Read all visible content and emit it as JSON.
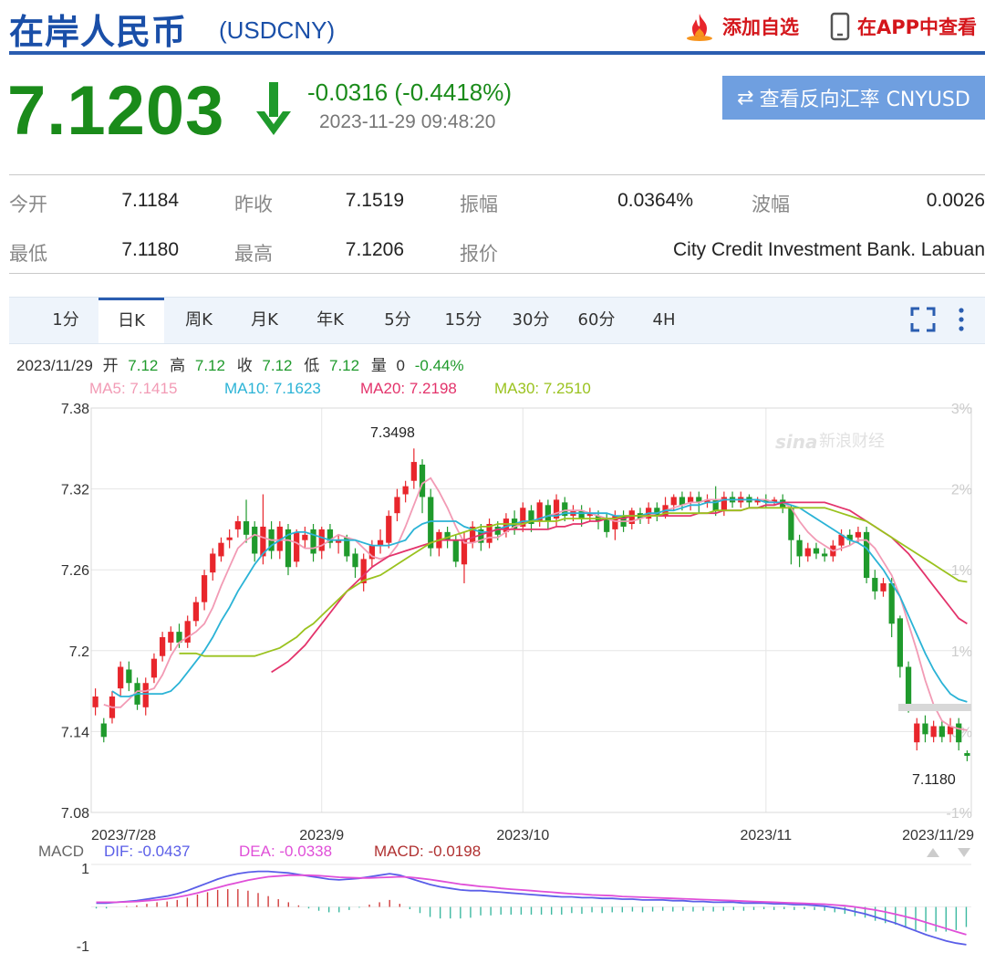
{
  "header": {
    "title": "在岸人民币",
    "code": "(USDCNY)",
    "add_label": "添加自选",
    "app_label": "在APP中查看"
  },
  "quote": {
    "price": "7.1203",
    "change": "-0.0316 (-0.4418%)",
    "time": "2023-11-29 09:48:20",
    "reverse_label": "查看反向汇率 CNYUSD"
  },
  "stats": {
    "open_label": "今开",
    "open": "7.1184",
    "prev_label": "昨收",
    "prev": "7.1519",
    "amp_label": "振幅",
    "amp": "0.0364%",
    "wave_label": "波幅",
    "wave": "0.0026",
    "low_label": "最低",
    "low": "7.1180",
    "high_label": "最高",
    "high": "7.1206",
    "quote_label": "报价",
    "quote": "City Credit Investment Bank. Labuan"
  },
  "tabs": [
    "1分",
    "日K",
    "周K",
    "月K",
    "年K",
    "5分",
    "15分",
    "30分",
    "60分",
    "4H"
  ],
  "active_tab": 1,
  "info_line": {
    "date": "2023/11/29",
    "open_label": "开",
    "open": "7.12",
    "high_label": "高",
    "high": "7.12",
    "close_label": "收",
    "close": "7.12",
    "low_label": "低",
    "low": "7.12",
    "vol_label": "量",
    "vol": "0",
    "pct": "-0.44%"
  },
  "ma_legend": [
    {
      "text": "MA5: 7.1415",
      "color": "#f29bb5"
    },
    {
      "text": "MA10: 7.1623",
      "color": "#2bb3d6"
    },
    {
      "text": "MA20: 7.2198",
      "color": "#e3336b"
    },
    {
      "text": "MA30: 7.2510",
      "color": "#9ac21e"
    }
  ],
  "watermark": "新浪财经",
  "macd_legend": {
    "label": "MACD",
    "dif": "DIF: -0.0437",
    "dea": "DEA: -0.0338",
    "macd": "MACD: -0.0198"
  },
  "colors": {
    "up": "#e8262c",
    "down": "#1f9a2c",
    "brand": "#1a4fa8",
    "price": "#1a8b1a"
  },
  "chart_data": {
    "type": "candlestick",
    "y_ticks_left": [
      "7.38",
      "7.32",
      "7.26",
      "7.2",
      "7.14",
      "7.08"
    ],
    "y_ticks_right": [
      "3%",
      "2%",
      "1%",
      "1%",
      "0%",
      "-1%"
    ],
    "ylim": [
      7.08,
      7.38
    ],
    "x_labels": [
      "2023/7/28",
      "2023/9",
      "2023/10",
      "2023/11",
      "2023/11/29"
    ],
    "x_label_index": [
      0,
      27,
      51,
      80,
      94
    ],
    "annotations": {
      "max": "7.3498",
      "min": "7.1180"
    },
    "candles": [
      [
        7.158,
        7.166,
        7.152,
        7.172
      ],
      [
        7.146,
        7.136,
        7.132,
        7.15
      ],
      [
        7.15,
        7.166,
        7.146,
        7.17
      ],
      [
        7.172,
        7.188,
        7.166,
        7.192
      ],
      [
        7.186,
        7.176,
        7.17,
        7.192
      ],
      [
        7.176,
        7.16,
        7.156,
        7.18
      ],
      [
        7.158,
        7.176,
        7.152,
        7.18
      ],
      [
        7.18,
        7.194,
        7.176,
        7.198
      ],
      [
        7.196,
        7.21,
        7.192,
        7.214
      ],
      [
        7.206,
        7.214,
        7.2,
        7.218
      ],
      [
        7.214,
        7.206,
        7.202,
        7.22
      ],
      [
        7.206,
        7.222,
        7.202,
        7.226
      ],
      [
        7.222,
        7.236,
        7.218,
        7.24
      ],
      [
        7.236,
        7.256,
        7.23,
        7.26
      ],
      [
        7.258,
        7.272,
        7.252,
        7.276
      ],
      [
        7.27,
        7.28,
        7.266,
        7.284
      ],
      [
        7.282,
        7.284,
        7.276,
        7.29
      ],
      [
        7.29,
        7.296,
        7.284,
        7.3
      ],
      [
        7.296,
        7.286,
        7.28,
        7.312
      ],
      [
        7.292,
        7.272,
        7.266,
        7.296
      ],
      [
        7.27,
        7.292,
        7.264,
        7.316
      ],
      [
        7.29,
        7.274,
        7.268,
        7.296
      ],
      [
        7.274,
        7.292,
        7.268,
        7.296
      ],
      [
        7.29,
        7.262,
        7.256,
        7.294
      ],
      [
        7.266,
        7.288,
        7.262,
        7.29
      ],
      [
        7.282,
        7.286,
        7.276,
        7.292
      ],
      [
        7.29,
        7.272,
        7.266,
        7.294
      ],
      [
        7.274,
        7.29,
        7.268,
        7.292
      ],
      [
        7.29,
        7.28,
        7.276,
        7.294
      ],
      [
        7.28,
        7.282,
        7.272,
        7.286
      ],
      [
        7.284,
        7.27,
        7.266,
        7.286
      ],
      [
        7.272,
        7.262,
        7.254,
        7.276
      ],
      [
        7.25,
        7.268,
        7.244,
        7.272
      ],
      [
        7.268,
        7.278,
        7.262,
        7.282
      ],
      [
        7.278,
        7.282,
        7.272,
        7.29
      ],
      [
        7.28,
        7.3,
        7.276,
        7.304
      ],
      [
        7.302,
        7.314,
        7.296,
        7.32
      ],
      [
        7.316,
        7.322,
        7.31,
        7.326
      ],
      [
        7.326,
        7.34,
        7.32,
        7.35
      ],
      [
        7.338,
        7.314,
        7.302,
        7.342
      ],
      [
        7.314,
        7.276,
        7.27,
        7.32
      ],
      [
        7.276,
        7.288,
        7.27,
        7.29
      ],
      [
        7.288,
        7.282,
        7.276,
        7.292
      ],
      [
        7.282,
        7.266,
        7.262,
        7.286
      ],
      [
        7.264,
        7.282,
        7.25,
        7.288
      ],
      [
        7.28,
        7.292,
        7.276,
        7.296
      ],
      [
        7.29,
        7.28,
        7.274,
        7.294
      ],
      [
        7.28,
        7.294,
        7.276,
        7.298
      ],
      [
        7.292,
        7.286,
        7.282,
        7.296
      ],
      [
        7.288,
        7.298,
        7.284,
        7.302
      ],
      [
        7.298,
        7.29,
        7.286,
        7.304
      ],
      [
        7.292,
        7.306,
        7.288,
        7.31
      ],
      [
        7.304,
        7.294,
        7.288,
        7.308
      ],
      [
        7.296,
        7.31,
        7.292,
        7.312
      ],
      [
        7.308,
        7.296,
        7.29,
        7.312
      ],
      [
        7.298,
        7.312,
        7.292,
        7.316
      ],
      [
        7.31,
        7.3,
        7.296,
        7.314
      ],
      [
        7.3,
        7.304,
        7.296,
        7.308
      ],
      [
        7.304,
        7.298,
        7.292,
        7.308
      ],
      [
        7.3,
        7.302,
        7.296,
        7.306
      ],
      [
        7.3,
        7.296,
        7.29,
        7.304
      ],
      [
        7.298,
        7.288,
        7.284,
        7.302
      ],
      [
        7.29,
        7.3,
        7.282,
        7.304
      ],
      [
        7.3,
        7.292,
        7.288,
        7.304
      ],
      [
        7.294,
        7.304,
        7.29,
        7.306
      ],
      [
        7.302,
        7.298,
        7.294,
        7.306
      ],
      [
        7.298,
        7.306,
        7.294,
        7.31
      ],
      [
        7.306,
        7.3,
        7.296,
        7.31
      ],
      [
        7.3,
        7.308,
        7.298,
        7.314
      ],
      [
        7.308,
        7.314,
        7.304,
        7.316
      ],
      [
        7.314,
        7.308,
        7.304,
        7.318
      ],
      [
        7.31,
        7.314,
        7.304,
        7.318
      ],
      [
        7.314,
        7.31,
        7.302,
        7.318
      ],
      [
        7.31,
        7.312,
        7.306,
        7.316
      ],
      [
        7.312,
        7.304,
        7.3,
        7.322
      ],
      [
        7.304,
        7.314,
        7.3,
        7.318
      ],
      [
        7.314,
        7.31,
        7.306,
        7.318
      ],
      [
        7.31,
        7.314,
        7.306,
        7.318
      ],
      [
        7.314,
        7.31,
        7.306,
        7.316
      ],
      [
        7.31,
        7.312,
        7.308,
        7.314
      ],
      [
        7.312,
        7.31,
        7.306,
        7.316
      ],
      [
        7.31,
        7.312,
        7.308,
        7.314
      ],
      [
        7.312,
        7.306,
        7.302,
        7.316
      ],
      [
        7.306,
        7.282,
        7.264,
        7.308
      ],
      [
        7.282,
        7.27,
        7.262,
        7.286
      ],
      [
        7.27,
        7.276,
        7.266,
        7.28
      ],
      [
        7.276,
        7.272,
        7.268,
        7.28
      ],
      [
        7.272,
        7.27,
        7.266,
        7.276
      ],
      [
        7.27,
        7.278,
        7.266,
        7.282
      ],
      [
        7.278,
        7.286,
        7.274,
        7.29
      ],
      [
        7.286,
        7.282,
        7.278,
        7.29
      ],
      [
        7.284,
        7.288,
        7.28,
        7.292
      ],
      [
        7.288,
        7.254,
        7.25,
        7.292
      ],
      [
        7.254,
        7.244,
        7.238,
        7.26
      ],
      [
        7.244,
        7.25,
        7.24,
        7.254
      ],
      [
        7.25,
        7.22,
        7.21,
        7.254
      ],
      [
        7.224,
        7.188,
        7.18,
        7.226
      ],
      [
        7.188,
        7.16,
        7.154,
        7.192
      ],
      [
        7.132,
        7.146,
        7.126,
        7.15
      ],
      [
        7.146,
        7.138,
        7.132,
        7.152
      ],
      [
        7.136,
        7.144,
        7.132,
        7.148
      ],
      [
        7.144,
        7.136,
        7.132,
        7.148
      ],
      [
        7.138,
        7.144,
        7.132,
        7.15
      ],
      [
        7.146,
        7.132,
        7.126,
        7.15
      ],
      [
        7.124,
        7.122,
        7.118,
        7.126
      ]
    ],
    "ma_values": {
      "MA5": [
        7.16,
        7.158,
        7.158,
        7.164,
        7.17,
        7.17,
        7.172,
        7.182,
        7.196,
        7.206,
        7.21,
        7.214,
        7.22,
        7.232,
        7.248,
        7.262,
        7.276,
        7.282,
        7.286,
        7.284,
        7.282,
        7.282,
        7.282,
        7.28,
        7.276,
        7.276,
        7.278,
        7.282,
        7.286,
        7.284,
        7.282,
        7.276,
        7.27,
        7.268,
        7.27,
        7.278,
        7.292,
        7.308,
        7.324,
        7.328,
        7.318,
        7.306,
        7.292,
        7.28,
        7.28,
        7.282,
        7.284,
        7.284,
        7.288,
        7.292,
        7.294,
        7.296,
        7.298,
        7.3,
        7.302,
        7.304,
        7.304,
        7.304,
        7.302,
        7.3,
        7.298,
        7.296,
        7.296,
        7.296,
        7.298,
        7.3,
        7.302,
        7.304,
        7.306,
        7.308,
        7.31,
        7.31,
        7.312,
        7.312,
        7.312,
        7.312,
        7.312,
        7.312,
        7.312,
        7.312,
        7.31,
        7.31,
        7.306,
        7.296,
        7.288,
        7.282,
        7.278,
        7.274,
        7.276,
        7.278,
        7.282,
        7.282,
        7.276,
        7.266,
        7.256,
        7.24,
        7.22,
        7.2,
        7.178,
        7.16,
        7.148,
        7.144,
        7.142,
        7.141
      ],
      "MA10": [
        7.17,
        7.166,
        7.166,
        7.168,
        7.168,
        7.168,
        7.168,
        7.17,
        7.176,
        7.184,
        7.192,
        7.2,
        7.21,
        7.222,
        7.232,
        7.244,
        7.254,
        7.264,
        7.272,
        7.278,
        7.282,
        7.286,
        7.288,
        7.288,
        7.286,
        7.284,
        7.282,
        7.282,
        7.282,
        7.282,
        7.28,
        7.278,
        7.278,
        7.278,
        7.28,
        7.282,
        7.29,
        7.294,
        7.296,
        7.296,
        7.296,
        7.296,
        7.292,
        7.29,
        7.288,
        7.288,
        7.29,
        7.292,
        7.294,
        7.296,
        7.296,
        7.298,
        7.3,
        7.3,
        7.302,
        7.302,
        7.302,
        7.302,
        7.302,
        7.302,
        7.3,
        7.3,
        7.3,
        7.3,
        7.302,
        7.302,
        7.304,
        7.304,
        7.306,
        7.308,
        7.308,
        7.31,
        7.31,
        7.312,
        7.312,
        7.312,
        7.312,
        7.312,
        7.31,
        7.31,
        7.31,
        7.308,
        7.306,
        7.302,
        7.298,
        7.294,
        7.29,
        7.286,
        7.282,
        7.28,
        7.276,
        7.268,
        7.26,
        7.25,
        7.24,
        7.226,
        7.212,
        7.198,
        7.186,
        7.176,
        7.168,
        7.164,
        7.162
      ],
      "MA20": [
        null,
        null,
        null,
        null,
        null,
        null,
        null,
        null,
        null,
        null,
        null,
        7.184,
        7.188,
        7.192,
        7.198,
        7.204,
        7.212,
        7.22,
        7.228,
        7.236,
        7.244,
        7.25,
        7.256,
        7.262,
        7.266,
        7.27,
        7.272,
        7.274,
        7.276,
        7.278,
        7.28,
        7.282,
        7.282,
        7.282,
        7.282,
        7.284,
        7.286,
        7.288,
        7.29,
        7.29,
        7.29,
        7.29,
        7.29,
        7.29,
        7.29,
        7.292,
        7.292,
        7.294,
        7.294,
        7.296,
        7.296,
        7.298,
        7.298,
        7.298,
        7.3,
        7.3,
        7.3,
        7.3,
        7.3,
        7.3,
        7.3,
        7.3,
        7.302,
        7.302,
        7.302,
        7.304,
        7.304,
        7.304,
        7.306,
        7.306,
        7.308,
        7.308,
        7.31,
        7.31,
        7.31,
        7.31,
        7.31,
        7.31,
        7.308,
        7.306,
        7.304,
        7.3,
        7.296,
        7.292,
        7.288,
        7.284,
        7.278,
        7.272,
        7.264,
        7.256,
        7.248,
        7.24,
        7.232,
        7.224,
        7.22
      ],
      "MA30": [
        7.198,
        7.198,
        7.198,
        7.196,
        7.196,
        7.196,
        7.196,
        7.196,
        7.196,
        7.196,
        7.198,
        7.2,
        7.202,
        7.206,
        7.21,
        7.216,
        7.22,
        7.226,
        7.232,
        7.238,
        7.244,
        7.248,
        7.252,
        7.254,
        7.256,
        7.26,
        7.264,
        7.268,
        7.272,
        7.276,
        7.28,
        7.282,
        7.284,
        7.286,
        7.288,
        7.29,
        7.292,
        7.292,
        7.294,
        7.294,
        7.294,
        7.294,
        7.296,
        7.296,
        7.296,
        7.296,
        7.298,
        7.298,
        7.298,
        7.298,
        7.298,
        7.298,
        7.298,
        7.3,
        7.3,
        7.3,
        7.3,
        7.3,
        7.302,
        7.302,
        7.302,
        7.302,
        7.302,
        7.302,
        7.304,
        7.304,
        7.304,
        7.304,
        7.306,
        7.306,
        7.306,
        7.306,
        7.306,
        7.306,
        7.306,
        7.306,
        7.306,
        7.306,
        7.304,
        7.302,
        7.3,
        7.298,
        7.296,
        7.292,
        7.288,
        7.284,
        7.28,
        7.276,
        7.272,
        7.268,
        7.264,
        7.26,
        7.256,
        7.252,
        7.251
      ]
    },
    "macd": {
      "dif": [
        0.1,
        0.1,
        0.12,
        0.14,
        0.16,
        0.2,
        0.24,
        0.28,
        0.34,
        0.42,
        0.52,
        0.62,
        0.72,
        0.8,
        0.86,
        0.9,
        0.92,
        0.92,
        0.9,
        0.88,
        0.84,
        0.8,
        0.76,
        0.72,
        0.7,
        0.72,
        0.74,
        0.78,
        0.82,
        0.86,
        0.82,
        0.74,
        0.66,
        0.58,
        0.52,
        0.48,
        0.44,
        0.42,
        0.42,
        0.4,
        0.38,
        0.36,
        0.34,
        0.32,
        0.3,
        0.28,
        0.26,
        0.26,
        0.24,
        0.24,
        0.22,
        0.22,
        0.2,
        0.2,
        0.18,
        0.18,
        0.18,
        0.16,
        0.16,
        0.14,
        0.14,
        0.12,
        0.12,
        0.12,
        0.1,
        0.1,
        0.1,
        0.08,
        0.08,
        0.06,
        0.06,
        0.04,
        0.02,
        -0.02,
        -0.06,
        -0.12,
        -0.18,
        -0.26,
        -0.34,
        -0.42,
        -0.52,
        -0.62,
        -0.72,
        -0.8,
        -0.88,
        -0.94,
        -0.98
      ],
      "dea": [
        0.12,
        0.12,
        0.12,
        0.13,
        0.14,
        0.16,
        0.18,
        0.21,
        0.25,
        0.3,
        0.36,
        0.43,
        0.5,
        0.57,
        0.63,
        0.69,
        0.74,
        0.78,
        0.8,
        0.82,
        0.82,
        0.82,
        0.81,
        0.79,
        0.77,
        0.76,
        0.75,
        0.75,
        0.76,
        0.77,
        0.78,
        0.77,
        0.74,
        0.71,
        0.67,
        0.63,
        0.59,
        0.56,
        0.53,
        0.51,
        0.48,
        0.46,
        0.44,
        0.42,
        0.4,
        0.38,
        0.36,
        0.34,
        0.33,
        0.31,
        0.3,
        0.29,
        0.27,
        0.26,
        0.25,
        0.24,
        0.23,
        0.22,
        0.21,
        0.2,
        0.19,
        0.18,
        0.17,
        0.16,
        0.15,
        0.14,
        0.13,
        0.12,
        0.11,
        0.1,
        0.09,
        0.08,
        0.07,
        0.05,
        0.03,
        0.0,
        -0.04,
        -0.08,
        -0.13,
        -0.19,
        -0.25,
        -0.32,
        -0.4,
        -0.48,
        -0.56,
        -0.64,
        -0.72
      ],
      "y_ticks": [
        "1",
        "-1"
      ]
    }
  }
}
